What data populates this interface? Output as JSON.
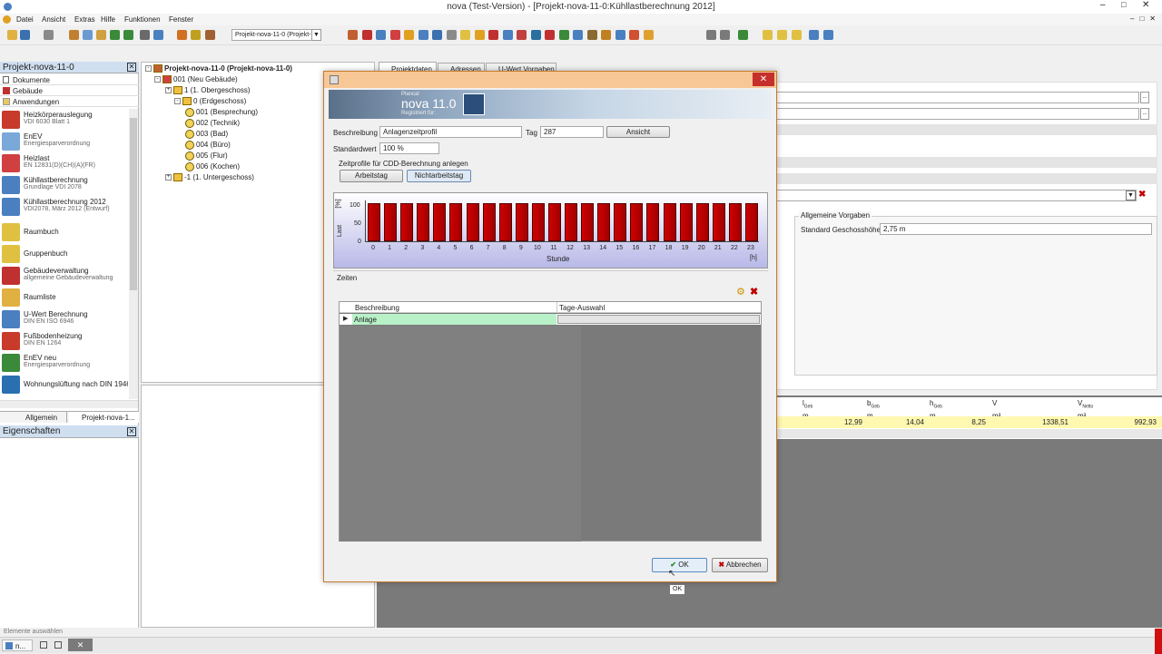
{
  "window": {
    "title": "nova (Test-Version) - [Projekt-nova-11-0:Kühllastberechnung 2012]"
  },
  "menu": [
    "Datei",
    "Ansicht",
    "Extras",
    "Hilfe",
    "Funktionen",
    "Fenster"
  ],
  "toolbar": {
    "project_select": "Projekt-nova-11-0 (Projekt-n"
  },
  "left_panel": {
    "title": "Projekt-nova-11-0",
    "sections": [
      "Dokumente",
      "Gebäude",
      "Anwendungen"
    ],
    "apps": [
      {
        "title": "Heizkörperauslegung",
        "sub": "VDI 6030 Blatt 1"
      },
      {
        "title": "EnEV",
        "sub": "Energiesparverordnung"
      },
      {
        "title": "Heizlast",
        "sub": "EN 12831(D)(CH)(A)(FR)"
      },
      {
        "title": "Kühllastberechnung",
        "sub": "Grundlage VDI 2078"
      },
      {
        "title": "Kühllastberechnung 2012",
        "sub": "VDI2078, März 2012 (Entwurf)"
      },
      {
        "title": "Raumbuch",
        "sub": ""
      },
      {
        "title": "Gruppenbuch",
        "sub": ""
      },
      {
        "title": "Gebäudeverwaltung",
        "sub": "allgemeine Gebäudeverwaltung"
      },
      {
        "title": "Raumliste",
        "sub": ""
      },
      {
        "title": "U-Wert Berechnung",
        "sub": "DIN EN ISO 6946"
      },
      {
        "title": "Fußbodenheizung",
        "sub": "DIN EN 1264"
      },
      {
        "title": "EnEV neu",
        "sub": "Energiesparverordnung"
      },
      {
        "title": "Wohnungslüftung nach DIN 1946",
        "sub": ""
      }
    ],
    "bottom_tabs": [
      "Allgemein",
      "Projekt-nova-1..."
    ],
    "properties_title": "Eigenschaften",
    "status": "Elemente auswählen"
  },
  "tree": [
    {
      "label": "Projekt-nova-11-0 (Projekt-nova-11-0)",
      "level": 0,
      "kind": "root"
    },
    {
      "label": "001 (Neu Gebäude)",
      "level": 1,
      "kind": "house"
    },
    {
      "label": "1 (1. Obergeschoss)",
      "level": 2,
      "kind": "floor"
    },
    {
      "label": "0 (Erdgeschoss)",
      "level": 2,
      "kind": "floor"
    },
    {
      "label": "001 (Besprechung)",
      "level": 3,
      "kind": "room"
    },
    {
      "label": "002 (Technik)",
      "level": 3,
      "kind": "room"
    },
    {
      "label": "003 (Bad)",
      "level": 3,
      "kind": "room"
    },
    {
      "label": "004 (Büro)",
      "level": 3,
      "kind": "room"
    },
    {
      "label": "005 (Flur)",
      "level": 3,
      "kind": "room"
    },
    {
      "label": "006 (Kochen)",
      "level": 3,
      "kind": "room"
    },
    {
      "label": "-1 (1. Untergeschoss)",
      "level": 2,
      "kind": "floor"
    }
  ],
  "right_panel": {
    "tabs": [
      "Projektdaten",
      "Adressen",
      "U-Wert Vorgaben"
    ],
    "group_title": "Allgemeine Vorgaben",
    "geschoss_label": "Standard Geschosshöhe",
    "geschoss_value": "2,75 m",
    "table_headers": [
      {
        "sym": "l",
        "sub": "Geb",
        "unit": "m"
      },
      {
        "sym": "b",
        "sub": "Geb",
        "unit": "m"
      },
      {
        "sym": "h",
        "sub": "Geb",
        "unit": "m"
      },
      {
        "sym": "V",
        "sub": "",
        "unit": "m³"
      },
      {
        "sym": "V",
        "sub": "Netto",
        "unit": "m³"
      }
    ],
    "table_values": [
      "12,99",
      "14,04",
      "8,25",
      "1338,51",
      "992,93"
    ]
  },
  "dialog": {
    "banner_small": "Plancal",
    "banner_title": "nova 11.0",
    "banner_sub": "Registriert für:",
    "beschreibung_label": "Beschreibung",
    "beschreibung_value": "Anlagenzeitprofil",
    "tag_label": "Tag",
    "tag_value": "287",
    "ansicht_btn": "Ansicht",
    "standardwert_label": "Standardwert",
    "standardwert_value": "100 %",
    "profile_group": "Zeitprofile für CDD-Berechnung anlegen",
    "arbeitstag_btn": "Arbeitstag",
    "nichtarbeitstag_btn": "Nichtarbeitstag",
    "zeiten_label": "Zeiten",
    "grid_col1": "Beschreibung",
    "grid_col2": "Tage-Auswahl",
    "grid_row1": "Anlage",
    "ok_btn": "OK",
    "cancel_btn": "Abbrechen",
    "tooltip": "OK"
  },
  "chart_data": {
    "type": "bar",
    "categories": [
      "0",
      "1",
      "2",
      "3",
      "4",
      "5",
      "6",
      "7",
      "8",
      "9",
      "10",
      "11",
      "12",
      "13",
      "14",
      "15",
      "16",
      "17",
      "18",
      "19",
      "20",
      "21",
      "22",
      "23"
    ],
    "values": [
      100,
      100,
      100,
      100,
      100,
      100,
      100,
      100,
      100,
      100,
      100,
      100,
      100,
      100,
      100,
      100,
      100,
      100,
      100,
      100,
      100,
      100,
      100,
      100
    ],
    "xlabel": "Stunde",
    "xunit": "[h]",
    "ylabel": "Last",
    "yunit": "[%]",
    "yticks": [
      "100",
      "50",
      "0"
    ],
    "ylim": [
      0,
      100
    ],
    "bar_color": "#d00000"
  },
  "taskbar": {
    "item": "n..."
  }
}
